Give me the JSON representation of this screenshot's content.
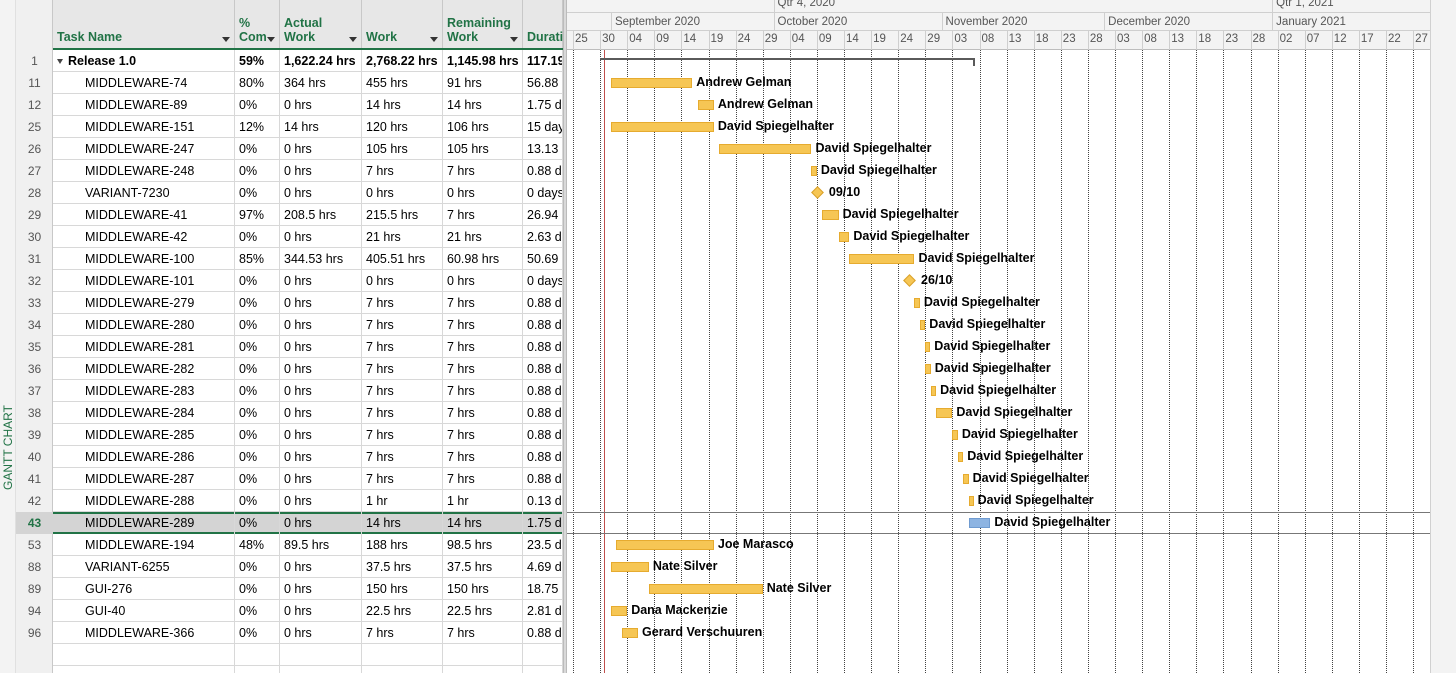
{
  "view_bar": {
    "label": "GANTT CHART"
  },
  "table": {
    "columns": [
      {
        "key": "name",
        "label": "Task Name"
      },
      {
        "key": "pct",
        "label": "%\nCom"
      },
      {
        "key": "actual",
        "label": "Actual\nWork"
      },
      {
        "key": "work",
        "label": "Work"
      },
      {
        "key": "remaining",
        "label": "Remaining\nWork"
      },
      {
        "key": "duration",
        "label": "Durati"
      }
    ],
    "rows": [
      {
        "id": "1",
        "name": "Release 1.0",
        "pct": "59%",
        "actual": "1,622.24 hrs",
        "work": "2,768.22 hrs",
        "remaining": "1,145.98 hrs",
        "duration": "117.19",
        "summary": true
      },
      {
        "id": "11",
        "name": "MIDDLEWARE-74",
        "pct": "80%",
        "actual": "364 hrs",
        "work": "455 hrs",
        "remaining": "91 hrs",
        "duration": "56.88"
      },
      {
        "id": "12",
        "name": "MIDDLEWARE-89",
        "pct": "0%",
        "actual": "0 hrs",
        "work": "14 hrs",
        "remaining": "14 hrs",
        "duration": "1.75 d"
      },
      {
        "id": "25",
        "name": "MIDDLEWARE-151",
        "pct": "12%",
        "actual": "14 hrs",
        "work": "120 hrs",
        "remaining": "106 hrs",
        "duration": "15 day"
      },
      {
        "id": "26",
        "name": "MIDDLEWARE-247",
        "pct": "0%",
        "actual": "0 hrs",
        "work": "105 hrs",
        "remaining": "105 hrs",
        "duration": "13.13"
      },
      {
        "id": "27",
        "name": "MIDDLEWARE-248",
        "pct": "0%",
        "actual": "0 hrs",
        "work": "7 hrs",
        "remaining": "7 hrs",
        "duration": "0.88 d"
      },
      {
        "id": "28",
        "name": "VARIANT-7230",
        "pct": "0%",
        "actual": "0 hrs",
        "work": "0 hrs",
        "remaining": "0 hrs",
        "duration": "0 days"
      },
      {
        "id": "29",
        "name": "MIDDLEWARE-41",
        "pct": "97%",
        "actual": "208.5 hrs",
        "work": "215.5 hrs",
        "remaining": "7 hrs",
        "duration": "26.94"
      },
      {
        "id": "30",
        "name": "MIDDLEWARE-42",
        "pct": "0%",
        "actual": "0 hrs",
        "work": "21 hrs",
        "remaining": "21 hrs",
        "duration": "2.63 d"
      },
      {
        "id": "31",
        "name": "MIDDLEWARE-100",
        "pct": "85%",
        "actual": "344.53 hrs",
        "work": "405.51 hrs",
        "remaining": "60.98 hrs",
        "duration": "50.69"
      },
      {
        "id": "32",
        "name": "MIDDLEWARE-101",
        "pct": "0%",
        "actual": "0 hrs",
        "work": "0 hrs",
        "remaining": "0 hrs",
        "duration": "0 days"
      },
      {
        "id": "33",
        "name": "MIDDLEWARE-279",
        "pct": "0%",
        "actual": "0 hrs",
        "work": "7 hrs",
        "remaining": "7 hrs",
        "duration": "0.88 d"
      },
      {
        "id": "34",
        "name": "MIDDLEWARE-280",
        "pct": "0%",
        "actual": "0 hrs",
        "work": "7 hrs",
        "remaining": "7 hrs",
        "duration": "0.88 d"
      },
      {
        "id": "35",
        "name": "MIDDLEWARE-281",
        "pct": "0%",
        "actual": "0 hrs",
        "work": "7 hrs",
        "remaining": "7 hrs",
        "duration": "0.88 d"
      },
      {
        "id": "36",
        "name": "MIDDLEWARE-282",
        "pct": "0%",
        "actual": "0 hrs",
        "work": "7 hrs",
        "remaining": "7 hrs",
        "duration": "0.88 d"
      },
      {
        "id": "37",
        "name": "MIDDLEWARE-283",
        "pct": "0%",
        "actual": "0 hrs",
        "work": "7 hrs",
        "remaining": "7 hrs",
        "duration": "0.88 d"
      },
      {
        "id": "38",
        "name": "MIDDLEWARE-284",
        "pct": "0%",
        "actual": "0 hrs",
        "work": "7 hrs",
        "remaining": "7 hrs",
        "duration": "0.88 d"
      },
      {
        "id": "39",
        "name": "MIDDLEWARE-285",
        "pct": "0%",
        "actual": "0 hrs",
        "work": "7 hrs",
        "remaining": "7 hrs",
        "duration": "0.88 d"
      },
      {
        "id": "40",
        "name": "MIDDLEWARE-286",
        "pct": "0%",
        "actual": "0 hrs",
        "work": "7 hrs",
        "remaining": "7 hrs",
        "duration": "0.88 d"
      },
      {
        "id": "41",
        "name": "MIDDLEWARE-287",
        "pct": "0%",
        "actual": "0 hrs",
        "work": "7 hrs",
        "remaining": "7 hrs",
        "duration": "0.88 d"
      },
      {
        "id": "42",
        "name": "MIDDLEWARE-288",
        "pct": "0%",
        "actual": "0 hrs",
        "work": "1 hr",
        "remaining": "1 hr",
        "duration": "0.13 d"
      },
      {
        "id": "43",
        "name": "MIDDLEWARE-289",
        "pct": "0%",
        "actual": "0 hrs",
        "work": "14 hrs",
        "remaining": "14 hrs",
        "duration": "1.75 d",
        "selected": true
      },
      {
        "id": "53",
        "name": "MIDDLEWARE-194",
        "pct": "48%",
        "actual": "89.5 hrs",
        "work": "188 hrs",
        "remaining": "98.5 hrs",
        "duration": "23.5 d"
      },
      {
        "id": "88",
        "name": "VARIANT-6255",
        "pct": "0%",
        "actual": "0 hrs",
        "work": "37.5 hrs",
        "remaining": "37.5 hrs",
        "duration": "4.69 d"
      },
      {
        "id": "89",
        "name": "GUI-276",
        "pct": "0%",
        "actual": "0 hrs",
        "work": "150 hrs",
        "remaining": "150 hrs",
        "duration": "18.75"
      },
      {
        "id": "94",
        "name": "GUI-40",
        "pct": "0%",
        "actual": "0 hrs",
        "work": "22.5 hrs",
        "remaining": "22.5 hrs",
        "duration": "2.81 d"
      },
      {
        "id": "96",
        "name": "MIDDLEWARE-366",
        "pct": "0%",
        "actual": "0 hrs",
        "work": "7 hrs",
        "remaining": "7 hrs",
        "duration": "0.88 d"
      }
    ]
  },
  "timescale": {
    "quarters": [
      "Qtr 4, 2020",
      "Qtr 1, 2021"
    ],
    "months": [
      "September 2020",
      "October 2020",
      "November 2020",
      "December 2020",
      "January 2021"
    ],
    "days": [
      "25",
      "30",
      "04",
      "09",
      "14",
      "19",
      "24",
      "29",
      "04",
      "09",
      "14",
      "19",
      "24",
      "29",
      "03",
      "08",
      "13",
      "18",
      "23",
      "28",
      "03",
      "08",
      "13",
      "18",
      "23",
      "28",
      "02",
      "07",
      "12",
      "17",
      "22",
      "27"
    ]
  },
  "gantt_bars": [
    {
      "row": 0,
      "type": "summary",
      "start": "2020-08-30",
      "end": "2020-11-07"
    },
    {
      "row": 1,
      "start": "2020-09-01",
      "end": "2020-09-16",
      "label": "Andrew Gelman"
    },
    {
      "row": 2,
      "start": "2020-09-17",
      "end": "2020-09-20",
      "label": "Andrew Gelman"
    },
    {
      "row": 3,
      "start": "2020-09-01",
      "end": "2020-09-20",
      "label": "David Spiegelhalter"
    },
    {
      "row": 4,
      "start": "2020-09-21",
      "end": "2020-10-08",
      "label": "David Spiegelhalter"
    },
    {
      "row": 5,
      "start": "2020-10-08",
      "end": "2020-10-09",
      "label": "David Spiegelhalter"
    },
    {
      "row": 6,
      "type": "milestone",
      "start": "2020-10-09",
      "label": "09/10"
    },
    {
      "row": 7,
      "start": "2020-10-10",
      "end": "2020-10-13",
      "label": "David Spiegelhalter"
    },
    {
      "row": 8,
      "start": "2020-10-13",
      "end": "2020-10-15",
      "label": "David Spiegelhalter"
    },
    {
      "row": 9,
      "start": "2020-10-15",
      "end": "2020-10-27",
      "label": "David Spiegelhalter"
    },
    {
      "row": 10,
      "type": "milestone",
      "start": "2020-10-26",
      "label": "26/10"
    },
    {
      "row": 11,
      "start": "2020-10-27",
      "end": "2020-10-28",
      "label": "David Spiegelhalter"
    },
    {
      "row": 12,
      "start": "2020-10-28",
      "end": "2020-10-29",
      "label": "David Spiegelhalter"
    },
    {
      "row": 13,
      "start": "2020-10-29",
      "end": "2020-10-29",
      "label": "David Spiegelhalter"
    },
    {
      "row": 14,
      "start": "2020-10-29",
      "end": "2020-10-30",
      "label": "David Spiegelhalter"
    },
    {
      "row": 15,
      "start": "2020-10-30",
      "end": "2020-10-31",
      "label": "David Spiegelhalter"
    },
    {
      "row": 16,
      "start": "2020-10-31",
      "end": "2020-11-03",
      "label": "David Spiegelhalter"
    },
    {
      "row": 17,
      "start": "2020-11-03",
      "end": "2020-11-04",
      "label": "David Spiegelhalter"
    },
    {
      "row": 18,
      "start": "2020-11-04",
      "end": "2020-11-05",
      "label": "David Spiegelhalter"
    },
    {
      "row": 19,
      "start": "2020-11-05",
      "end": "2020-11-06",
      "label": "David Spiegelhalter"
    },
    {
      "row": 20,
      "start": "2020-11-06",
      "end": "2020-11-06",
      "label": "David Spiegelhalter"
    },
    {
      "row": 21,
      "start": "2020-11-06",
      "end": "2020-11-10",
      "label": "David Spiegelhalter",
      "color": "blue"
    },
    {
      "row": 22,
      "start": "2020-09-02",
      "end": "2020-09-20",
      "label": "Joe Marasco"
    },
    {
      "row": 23,
      "start": "2020-09-01",
      "end": "2020-09-08",
      "label": "Nate Silver"
    },
    {
      "row": 24,
      "start": "2020-09-08",
      "end": "2020-09-29",
      "label": "Nate Silver"
    },
    {
      "row": 25,
      "start": "2020-09-01",
      "end": "2020-09-04",
      "label": "Dana Mackenzie"
    },
    {
      "row": 26,
      "start": "2020-09-03",
      "end": "2020-09-06",
      "label": "Gerard Verschuuren"
    }
  ]
}
